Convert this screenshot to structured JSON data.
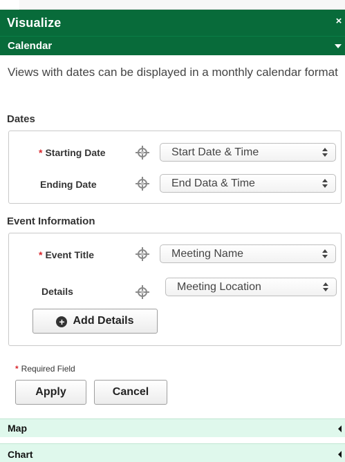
{
  "panel": {
    "title": "Visualize",
    "close_glyph": "×"
  },
  "section": {
    "label": "Calendar"
  },
  "intro": "Views with dates can be displayed in a monthly calendar format",
  "dates": {
    "title": "Dates",
    "starting_label": "Starting Date",
    "starting_value": "Start Date & Time",
    "ending_label": "Ending Date",
    "ending_value": "End Data & Time"
  },
  "event": {
    "title": "Event Information",
    "event_title_label": "Event Title",
    "event_title_value": "Meeting Name",
    "details_label": "Details",
    "details_value": "Meeting Location",
    "add_details_label": "Add Details"
  },
  "required_mark": "*",
  "required_note": "Required Field",
  "actions": {
    "apply": "Apply",
    "cancel": "Cancel"
  },
  "accordion": [
    {
      "label": "Map"
    },
    {
      "label": "Chart"
    }
  ],
  "icons": {
    "field_target": "crosshair-icon",
    "add": "plus-circle-icon",
    "select": "updown-arrows-icon"
  },
  "colors": {
    "header": "#086b3a",
    "accordion": "#dff8ec",
    "required": "#d9262c"
  }
}
